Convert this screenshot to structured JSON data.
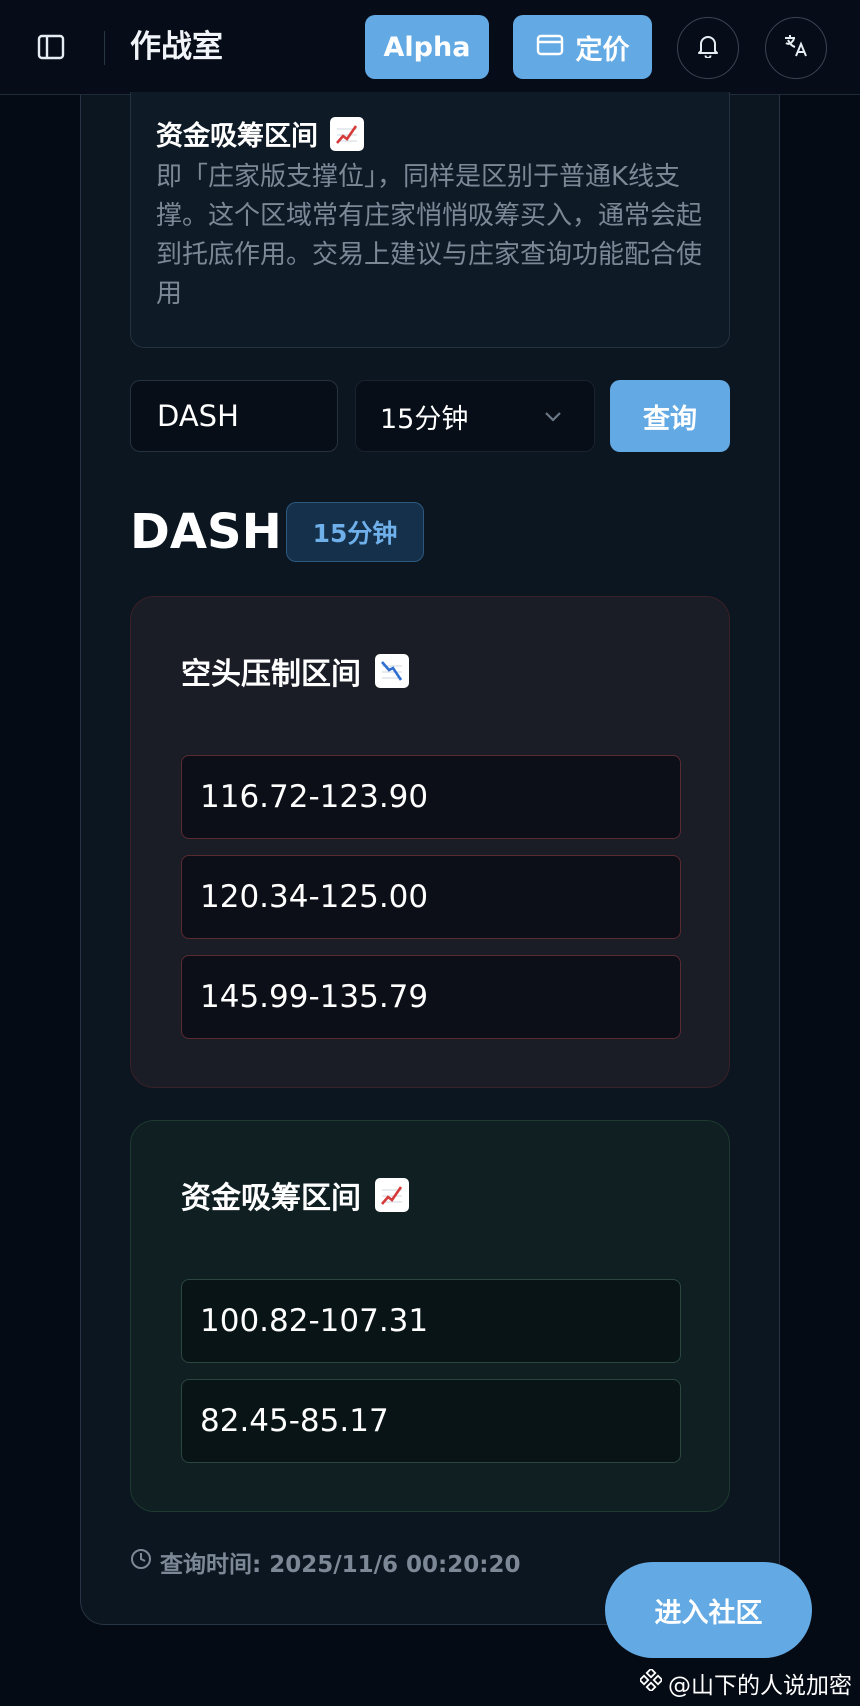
{
  "header": {
    "title": "作战室",
    "alpha_label": "Alpha",
    "pricing_label": "定价",
    "icons": {
      "sidebar": "sidebar-toggle-icon",
      "card": "credit-card-icon",
      "bell": "bell-icon",
      "translate": "translate-icon"
    }
  },
  "info": {
    "title": "资金吸筹区间",
    "description": "即「庄家版支撑位」，同样是区别于普通K线支撑。这个区域常有庄家悄悄吸筹买入，通常会起到托底作用。交易上建议与庄家查询功能配合使用"
  },
  "query": {
    "symbol_value": "DASH",
    "interval_value": "15分钟",
    "submit_label": "查询"
  },
  "result": {
    "symbol": "DASH",
    "interval": "15分钟",
    "bear_zone": {
      "title": "空头压制区间",
      "ranges": [
        "116.72-123.90",
        "120.34-125.00",
        "145.99-135.79"
      ]
    },
    "bull_zone": {
      "title": "资金吸筹区间",
      "ranges": [
        "100.82-107.31",
        "82.45-85.17"
      ]
    },
    "query_time": "查询时间: 2025/11/6 00:20:20"
  },
  "community_label": "进入社区",
  "watermark": "@山下的人说加密",
  "colors": {
    "accent": "#63a9e4",
    "bear_border": "#5a2a31",
    "bull_border": "#2c4740",
    "background": "#050b14"
  }
}
